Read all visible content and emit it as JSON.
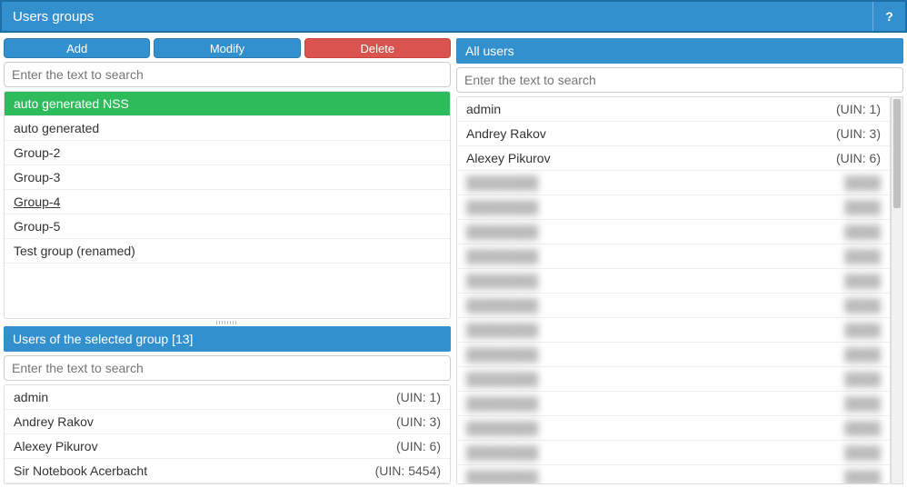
{
  "title": "Users groups",
  "help": "?",
  "buttons": {
    "add": "Add",
    "modify": "Modify",
    "delete": "Delete"
  },
  "search_placeholder": "Enter the text to search",
  "groups": [
    {
      "name": "auto generated NSS",
      "selected": true
    },
    {
      "name": "auto generated"
    },
    {
      "name": "Group-2"
    },
    {
      "name": "Group-3"
    },
    {
      "name": "Group-4",
      "hover": true
    },
    {
      "name": "Group-5"
    },
    {
      "name": "Test group (renamed)"
    }
  ],
  "selected_group_header": "Users of the selected group [13]",
  "selected_users": [
    {
      "name": "admin",
      "uin": "(UIN: 1)"
    },
    {
      "name": "Andrey Rakov",
      "uin": "(UIN: 3)"
    },
    {
      "name": "Alexey Pikurov",
      "uin": "(UIN: 6)"
    },
    {
      "name": "Sir Notebook Acerbacht",
      "uin": "(UIN: 5454)"
    }
  ],
  "all_users_header": "All users",
  "all_users": [
    {
      "name": "admin",
      "uin": "(UIN: 1)"
    },
    {
      "name": "Andrey Rakov",
      "uin": "(UIN: 3)"
    },
    {
      "name": "Alexey Pikurov",
      "uin": "(UIN: 6)"
    },
    {
      "name": "████████",
      "uin": "████",
      "blurred": true
    },
    {
      "name": "████████",
      "uin": "████",
      "blurred": true
    },
    {
      "name": "████████",
      "uin": "████",
      "blurred": true
    },
    {
      "name": "████████",
      "uin": "████",
      "blurred": true
    },
    {
      "name": "████████",
      "uin": "████",
      "blurred": true
    },
    {
      "name": "████████",
      "uin": "████",
      "blurred": true
    },
    {
      "name": "████████",
      "uin": "████",
      "blurred": true
    },
    {
      "name": "████████",
      "uin": "████",
      "blurred": true
    },
    {
      "name": "████████",
      "uin": "████",
      "blurred": true
    },
    {
      "name": "████████",
      "uin": "████",
      "blurred": true
    },
    {
      "name": "████████",
      "uin": "████",
      "blurred": true
    },
    {
      "name": "████████",
      "uin": "████",
      "blurred": true
    },
    {
      "name": "████████",
      "uin": "████",
      "blurred": true
    }
  ]
}
